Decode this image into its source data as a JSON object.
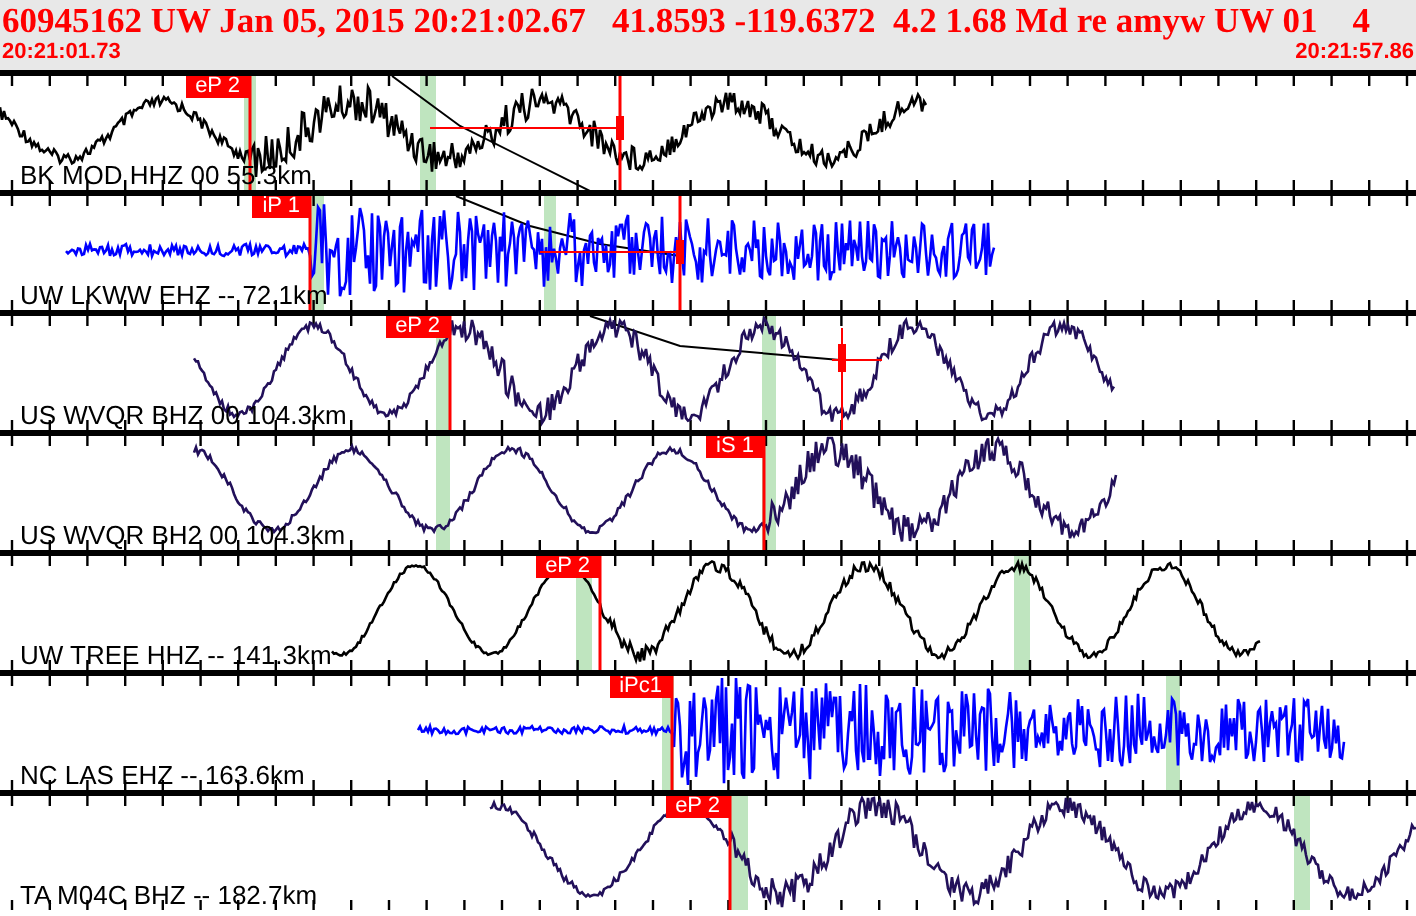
{
  "header": {
    "event_line": "60945162 UW Jan 05, 2015 20:21:02.67   41.8593 -119.6372  4.2 1.68 Md re amyw UW 01    4",
    "start_time": "20:21:01.73",
    "end_time": "20:21:57.86"
  },
  "traces": [
    {
      "station": "BK MOD HHZ 00 55.3km",
      "color": "#000000",
      "pick": "eP 2"
    },
    {
      "station": "UW LKWW EHZ -- 72.1km",
      "color": "#0000ff",
      "pick": "iP 1"
    },
    {
      "station": "US WVQR BHZ 00 104.3km",
      "color": "#22105a",
      "pick": "eP 2"
    },
    {
      "station": "US WVQR BH2 00 104.3km",
      "color": "#22105a",
      "pick": "iS 1"
    },
    {
      "station": "UW TREE HHZ -- 141.3km",
      "color": "#000000",
      "pick": "eP 2"
    },
    {
      "station": "NC LAS EHZ -- 163.6km",
      "color": "#0000ff",
      "pick": "iPc1"
    },
    {
      "station": "TA M04C BHZ -- 182.7km",
      "color": "#22105a",
      "pick": "eP 2"
    }
  ]
}
